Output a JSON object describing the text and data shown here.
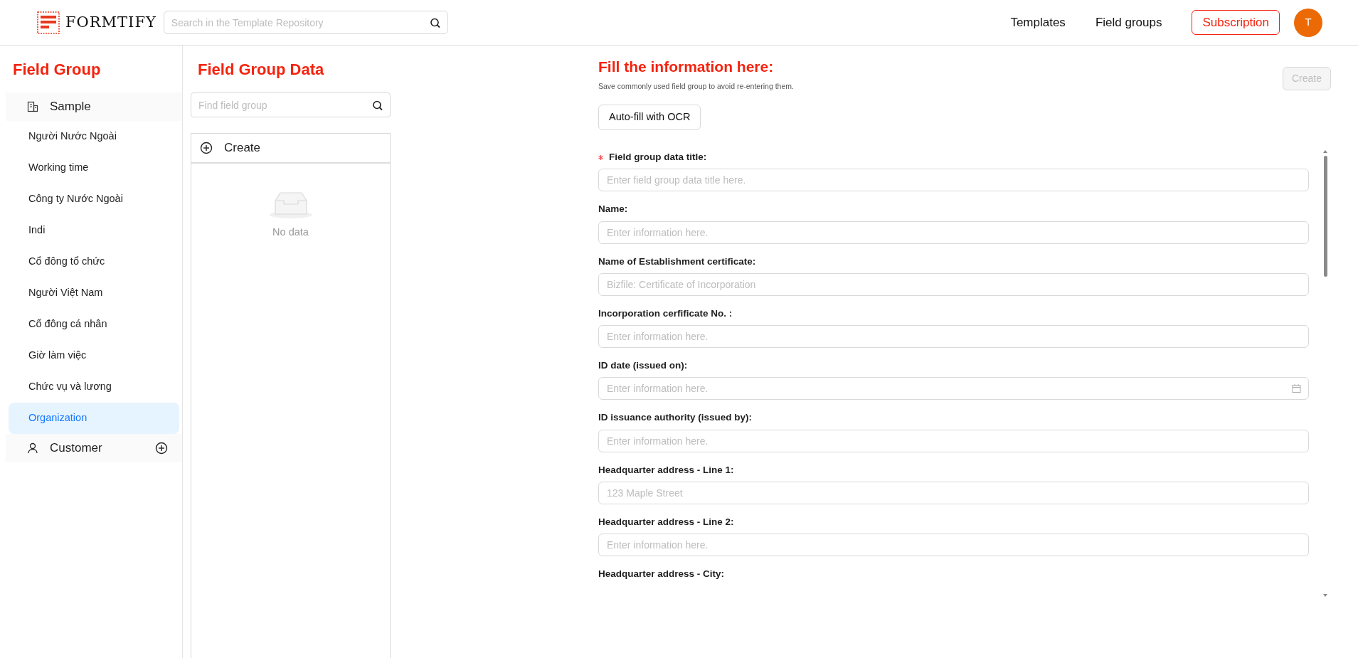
{
  "header": {
    "logo": "FORMTIFY",
    "search": {
      "placeholder": "Search in the Template Repository"
    },
    "nav": [
      {
        "label": "Templates"
      },
      {
        "label": "Field groups"
      }
    ],
    "subscription": "Subscription",
    "avatar": "T"
  },
  "sidebar": {
    "title": "Field Group",
    "groups": [
      {
        "label": "Sample",
        "expanded": true,
        "children": [
          {
            "label": "Người Nước Ngoài",
            "selected": false
          },
          {
            "label": "Working time",
            "selected": false
          },
          {
            "label": "Công ty Nước Ngoài",
            "selected": false
          },
          {
            "label": "Indi",
            "selected": false
          },
          {
            "label": "Cổ đông tổ chức",
            "selected": false
          },
          {
            "label": "Người Việt Nam",
            "selected": false
          },
          {
            "label": "Cổ đông cá nhân",
            "selected": false
          },
          {
            "label": "Giờ làm việc",
            "selected": false
          },
          {
            "label": "Chức vụ và lương",
            "selected": false
          },
          {
            "label": "Organization",
            "selected": true
          }
        ]
      },
      {
        "label": "Customer",
        "expanded": false
      }
    ]
  },
  "middle": {
    "title": "Field Group Data",
    "search": {
      "placeholder": "Find field group"
    },
    "create": "Create",
    "empty": "No data"
  },
  "form": {
    "title": "Fill the information here:",
    "subtitle": "Save commonly used field group to avoid re-entering them.",
    "create_button": {
      "label": "Create",
      "disabled": true
    },
    "ocr_button": "Auto-fill with OCR",
    "fields": [
      {
        "label": "Field group data title:",
        "placeholder": "Enter field group data title here.",
        "required": true,
        "kind": "text"
      },
      {
        "label": "Name:",
        "placeholder": "Enter information here.",
        "required": false,
        "kind": "text"
      },
      {
        "label": "Name of Establishment certificate:",
        "placeholder": "Bizfile: Certificate of Incorporation",
        "required": false,
        "kind": "text"
      },
      {
        "label": "Incorporation cerfificate No. :",
        "placeholder": "Enter information here.",
        "required": false,
        "kind": "text"
      },
      {
        "label": "ID date (issued on):",
        "placeholder": "Enter information here.",
        "required": false,
        "kind": "date"
      },
      {
        "label": "ID issuance authority (issued by):",
        "placeholder": "Enter information here.",
        "required": false,
        "kind": "text"
      },
      {
        "label": "Headquarter address - Line 1:",
        "placeholder": "123 Maple Street",
        "required": false,
        "kind": "text"
      },
      {
        "label": "Headquarter address - Line 2:",
        "placeholder": "Enter information here.",
        "required": false,
        "kind": "text"
      },
      {
        "label": "Headquarter address - City:",
        "required": false,
        "kind": "label"
      }
    ]
  }
}
